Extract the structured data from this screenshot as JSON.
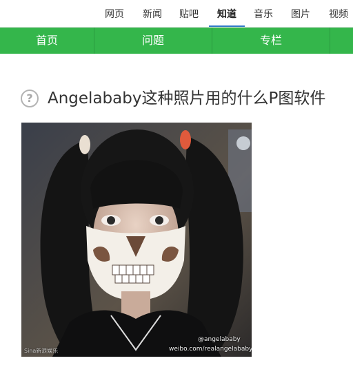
{
  "top_tabs": [
    {
      "label": "网页",
      "active": false
    },
    {
      "label": "新闻",
      "active": false
    },
    {
      "label": "贴吧",
      "active": false
    },
    {
      "label": "知道",
      "active": true
    },
    {
      "label": "音乐",
      "active": false
    },
    {
      "label": "图片",
      "active": false
    },
    {
      "label": "视频",
      "active": false
    }
  ],
  "nav": {
    "items": [
      "首页",
      "问题",
      "专栏"
    ],
    "background_color": "#34b64b"
  },
  "question": {
    "icon": "question-circle-icon",
    "title": "Angelababy这种照片用的什么P图软件"
  },
  "photo": {
    "description_icon": "photo-image",
    "watermark_handle": "@angelababy",
    "watermark_url": "weibo.com/realangelababy",
    "watermark_left": "Sina新浪娱乐"
  },
  "colors": {
    "active_tab_underline": "#3279c9",
    "nav_green": "#34b64b"
  }
}
